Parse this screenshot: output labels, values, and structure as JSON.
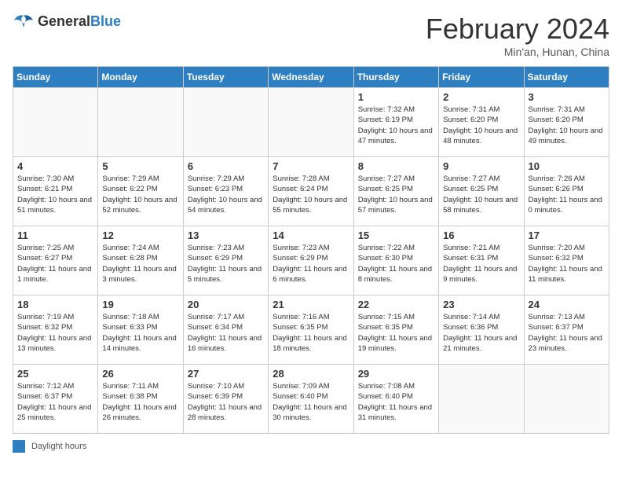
{
  "header": {
    "logo_general": "General",
    "logo_blue": "Blue",
    "title": "February 2024",
    "location": "Min'an, Hunan, China"
  },
  "days_of_week": [
    "Sunday",
    "Monday",
    "Tuesday",
    "Wednesday",
    "Thursday",
    "Friday",
    "Saturday"
  ],
  "weeks": [
    [
      {
        "day": "",
        "info": ""
      },
      {
        "day": "",
        "info": ""
      },
      {
        "day": "",
        "info": ""
      },
      {
        "day": "",
        "info": ""
      },
      {
        "day": "1",
        "info": "Sunrise: 7:32 AM\nSunset: 6:19 PM\nDaylight: 10 hours and 47 minutes."
      },
      {
        "day": "2",
        "info": "Sunrise: 7:31 AM\nSunset: 6:20 PM\nDaylight: 10 hours and 48 minutes."
      },
      {
        "day": "3",
        "info": "Sunrise: 7:31 AM\nSunset: 6:20 PM\nDaylight: 10 hours and 49 minutes."
      }
    ],
    [
      {
        "day": "4",
        "info": "Sunrise: 7:30 AM\nSunset: 6:21 PM\nDaylight: 10 hours and 51 minutes."
      },
      {
        "day": "5",
        "info": "Sunrise: 7:29 AM\nSunset: 6:22 PM\nDaylight: 10 hours and 52 minutes."
      },
      {
        "day": "6",
        "info": "Sunrise: 7:29 AM\nSunset: 6:23 PM\nDaylight: 10 hours and 54 minutes."
      },
      {
        "day": "7",
        "info": "Sunrise: 7:28 AM\nSunset: 6:24 PM\nDaylight: 10 hours and 55 minutes."
      },
      {
        "day": "8",
        "info": "Sunrise: 7:27 AM\nSunset: 6:25 PM\nDaylight: 10 hours and 57 minutes."
      },
      {
        "day": "9",
        "info": "Sunrise: 7:27 AM\nSunset: 6:25 PM\nDaylight: 10 hours and 58 minutes."
      },
      {
        "day": "10",
        "info": "Sunrise: 7:26 AM\nSunset: 6:26 PM\nDaylight: 11 hours and 0 minutes."
      }
    ],
    [
      {
        "day": "11",
        "info": "Sunrise: 7:25 AM\nSunset: 6:27 PM\nDaylight: 11 hours and 1 minute."
      },
      {
        "day": "12",
        "info": "Sunrise: 7:24 AM\nSunset: 6:28 PM\nDaylight: 11 hours and 3 minutes."
      },
      {
        "day": "13",
        "info": "Sunrise: 7:23 AM\nSunset: 6:29 PM\nDaylight: 11 hours and 5 minutes."
      },
      {
        "day": "14",
        "info": "Sunrise: 7:23 AM\nSunset: 6:29 PM\nDaylight: 11 hours and 6 minutes."
      },
      {
        "day": "15",
        "info": "Sunrise: 7:22 AM\nSunset: 6:30 PM\nDaylight: 11 hours and 8 minutes."
      },
      {
        "day": "16",
        "info": "Sunrise: 7:21 AM\nSunset: 6:31 PM\nDaylight: 11 hours and 9 minutes."
      },
      {
        "day": "17",
        "info": "Sunrise: 7:20 AM\nSunset: 6:32 PM\nDaylight: 11 hours and 11 minutes."
      }
    ],
    [
      {
        "day": "18",
        "info": "Sunrise: 7:19 AM\nSunset: 6:32 PM\nDaylight: 11 hours and 13 minutes."
      },
      {
        "day": "19",
        "info": "Sunrise: 7:18 AM\nSunset: 6:33 PM\nDaylight: 11 hours and 14 minutes."
      },
      {
        "day": "20",
        "info": "Sunrise: 7:17 AM\nSunset: 6:34 PM\nDaylight: 11 hours and 16 minutes."
      },
      {
        "day": "21",
        "info": "Sunrise: 7:16 AM\nSunset: 6:35 PM\nDaylight: 11 hours and 18 minutes."
      },
      {
        "day": "22",
        "info": "Sunrise: 7:15 AM\nSunset: 6:35 PM\nDaylight: 11 hours and 19 minutes."
      },
      {
        "day": "23",
        "info": "Sunrise: 7:14 AM\nSunset: 6:36 PM\nDaylight: 11 hours and 21 minutes."
      },
      {
        "day": "24",
        "info": "Sunrise: 7:13 AM\nSunset: 6:37 PM\nDaylight: 11 hours and 23 minutes."
      }
    ],
    [
      {
        "day": "25",
        "info": "Sunrise: 7:12 AM\nSunset: 6:37 PM\nDaylight: 11 hours and 25 minutes."
      },
      {
        "day": "26",
        "info": "Sunrise: 7:11 AM\nSunset: 6:38 PM\nDaylight: 11 hours and 26 minutes."
      },
      {
        "day": "27",
        "info": "Sunrise: 7:10 AM\nSunset: 6:39 PM\nDaylight: 11 hours and 28 minutes."
      },
      {
        "day": "28",
        "info": "Sunrise: 7:09 AM\nSunset: 6:40 PM\nDaylight: 11 hours and 30 minutes."
      },
      {
        "day": "29",
        "info": "Sunrise: 7:08 AM\nSunset: 6:40 PM\nDaylight: 11 hours and 31 minutes."
      },
      {
        "day": "",
        "info": ""
      },
      {
        "day": "",
        "info": ""
      }
    ]
  ],
  "footer": {
    "legend_label": "Daylight hours"
  }
}
